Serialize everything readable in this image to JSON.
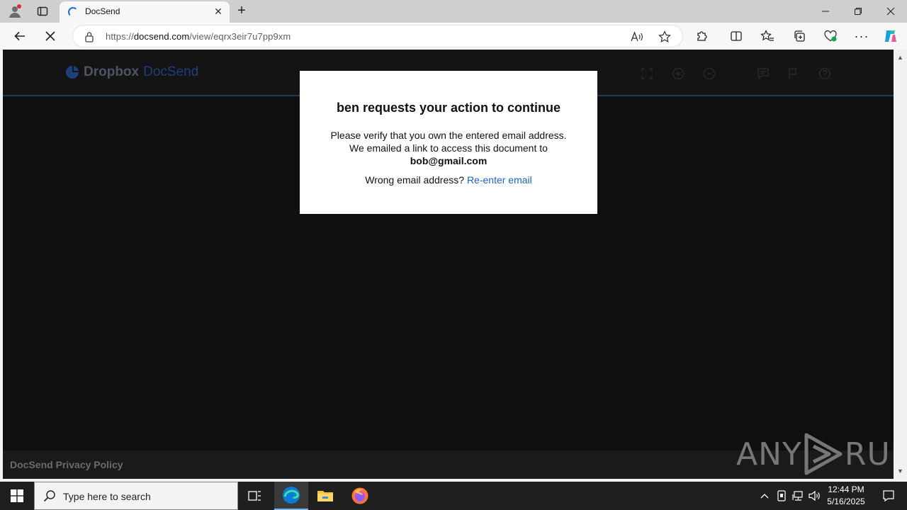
{
  "browser": {
    "tab": {
      "title": "DocSend"
    },
    "address": {
      "url_prefix": "https://",
      "url_host": "docsend.com",
      "url_path": "/view/eqrx3eir7u7pp9xm"
    }
  },
  "page": {
    "logo": {
      "brand": "Dropbox",
      "product": "DocSend"
    },
    "modal": {
      "title": "ben requests your action to continue",
      "line1": "Please verify that you own the entered email address.",
      "line2": "We emailed a link to access this document to",
      "email": "bob@gmail.com",
      "wrong_prompt": "Wrong email address?",
      "reenter_link": "Re-enter email"
    },
    "footer": {
      "privacy_link": "DocSend Privacy Policy"
    },
    "watermark": {
      "left": "ANY",
      "right": "RUN"
    }
  },
  "taskbar": {
    "search_placeholder": "Type here to search",
    "time": "12:44 PM",
    "date": "5/16/2025"
  },
  "colors": {
    "accent": "#1e6fd9",
    "link": "#1565c0",
    "page_bg": "#0f0f0f"
  }
}
